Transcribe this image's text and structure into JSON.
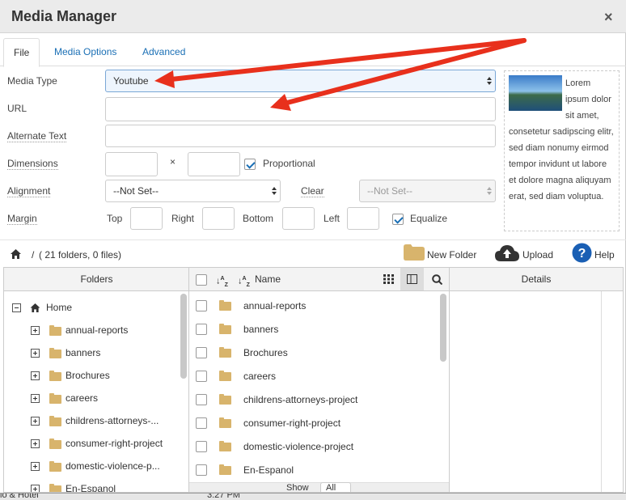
{
  "dialog": {
    "title": "Media Manager",
    "close": "×"
  },
  "tabs": [
    "File",
    "Media Options",
    "Advanced"
  ],
  "form": {
    "media_type_label": "Media Type",
    "media_type_value": "Youtube",
    "url_label": "URL",
    "alt_label": "Alternate Text",
    "dims_label": "Dimensions",
    "dims_x": "×",
    "proportional_label": "Proportional",
    "proportional_checked": true,
    "align_label": "Alignment",
    "align_value": "--Not Set--",
    "clear_label": "Clear",
    "clear_value": "--Not Set--",
    "margin_label": "Margin",
    "top_label": "Top",
    "right_label": "Right",
    "bottom_label": "Bottom",
    "left_label": "Left",
    "equalize_label": "Equalize",
    "equalize_checked": true
  },
  "preview": {
    "text": "Lorem ipsum dolor sit amet, consetetur sadipscing elitr, sed diam nonumy eirmod tempor invidunt ut labore et dolore magna aliquyam erat, sed diam voluptua."
  },
  "toolbar": {
    "path_sep": "/",
    "path_info": "( 21 folders, 0 files)",
    "new_folder": "New Folder",
    "upload": "Upload",
    "help": "Help"
  },
  "folders_pane": {
    "header": "Folders",
    "home": "Home",
    "items": [
      "annual-reports",
      "banners",
      "Brochures",
      "careers",
      "childrens-attorneys-...",
      "consumer-right-project",
      "domestic-violence-p...",
      "En-Espanol"
    ]
  },
  "files_pane": {
    "name_header": "Name",
    "items": [
      "annual-reports",
      "banners",
      "Brochures",
      "careers",
      "childrens-attorneys-project",
      "consumer-right-project",
      "domestic-violence-project",
      "En-Espanol"
    ],
    "show_label": "Show",
    "show_value": "All"
  },
  "details_pane": {
    "header": "Details"
  },
  "taskbar": {
    "left": "io & Hotel",
    "time": "3:27 PM"
  },
  "colors": {
    "link": "#1a6fb5",
    "arrow": "#e8301c",
    "help": "#1a5fb4"
  }
}
